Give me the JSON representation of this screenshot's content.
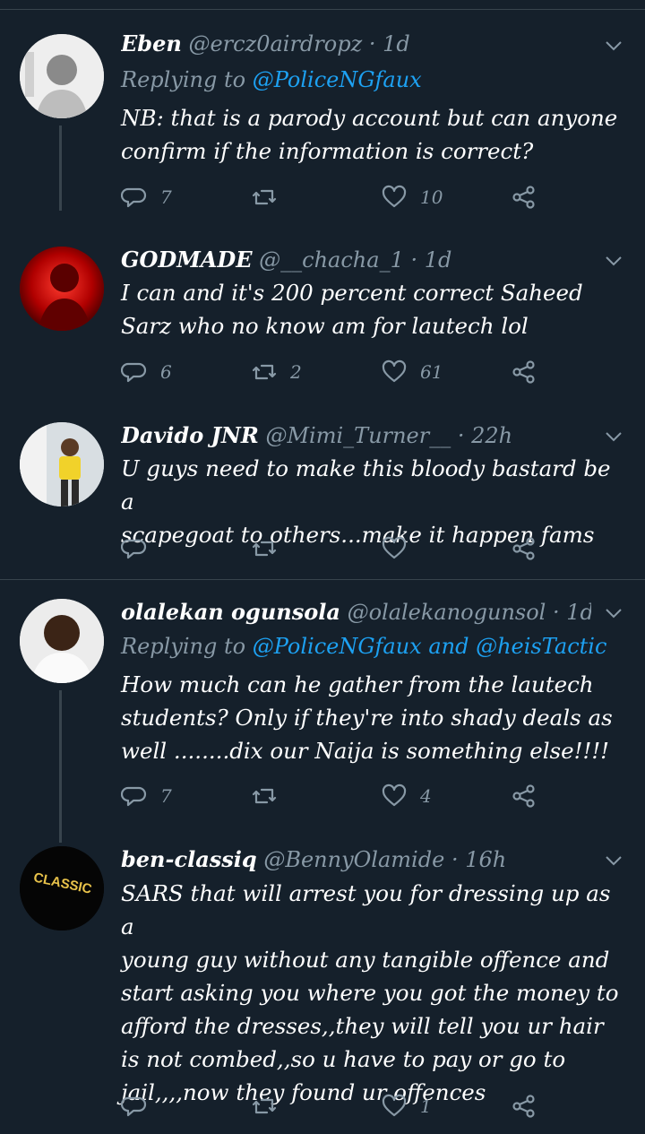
{
  "colors": {
    "background": "#15202b",
    "secondary": "#8899a6",
    "link": "#1da1f2",
    "divider": "#38444d"
  },
  "tweets": [
    {
      "name": "Eben",
      "handle": "@ercz0airdropz",
      "dot": "·",
      "time": "1d",
      "replying_prefix": "Replying to",
      "replying_to": "@PoliceNGfaux",
      "lines": [
        "NB: that is a parody account but can anyone",
        "confirm if the information is correct?"
      ],
      "replies": "7",
      "retweets": "",
      "likes": "10"
    },
    {
      "name": "GODMADE",
      "handle": "@__chacha_1",
      "dot": "·",
      "time": "1d",
      "lines": [
        "I can and it's 200 percent correct Saheed",
        "Sarz who no know am for lautech lol"
      ],
      "replies": "6",
      "retweets": "2",
      "likes": "61"
    },
    {
      "name": "Davido JNR",
      "handle": "@Mimi_Turner__",
      "dot": "·",
      "time": "22h",
      "lines": [
        "U guys need to make this bloody bastard be a",
        "scapegoat to others...make it happen fams"
      ],
      "replies": "",
      "retweets": "",
      "likes": ""
    },
    {
      "name": "olalekan ogunsola",
      "handle": "@olalekanogunsol",
      "dot": "·",
      "time": "1d",
      "replying_prefix": "Replying to",
      "replying_to": "@PoliceNGfaux and @heisTactic",
      "lines": [
        "How much can he gather from the lautech",
        "students? Only if they're into shady deals as",
        "well ........dix our Naija is something else!!!!"
      ],
      "replies": "7",
      "retweets": "",
      "likes": "4"
    },
    {
      "name": "ben-classiq",
      "handle": "@BennyOlamide",
      "dot": "·",
      "time": "16h",
      "avatar_text": "CLASSIC",
      "lines": [
        "SARS that will arrest you for dressing up as a",
        "young guy without any tangible offence and",
        "start asking you where you got the money to",
        "afford the dresses,,they will tell you ur hair",
        "is not combed,,so u have to pay or go to",
        "jail,,,,now they found ur offences"
      ],
      "replies": "",
      "retweets": "",
      "likes": "1"
    }
  ]
}
